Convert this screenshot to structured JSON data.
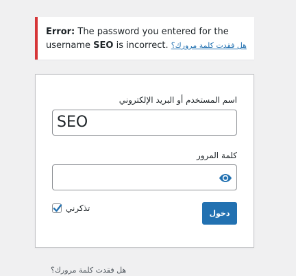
{
  "notice": {
    "error_label": "Error:",
    "message_before": "The password you entered for the username",
    "username": "SEO",
    "message_after": "is incorrect.",
    "lost_password_link": "هل فقدت كلمة مرورك؟"
  },
  "login_form": {
    "username_label": "اسم المستخدم أو البريد الإلكتروني",
    "username_value": "SEO",
    "password_label": "كلمة المرور",
    "password_value": "",
    "show_password_icon": "eye-icon",
    "remember_label": "تذكرني",
    "remember_checked": true,
    "submit_label": "دخول"
  },
  "footer": {
    "lost_password_link": "هل فقدت كلمة مرورك؟"
  },
  "colors": {
    "error_border": "#d63638",
    "primary": "#2271b1",
    "background": "#f0f0f1"
  }
}
